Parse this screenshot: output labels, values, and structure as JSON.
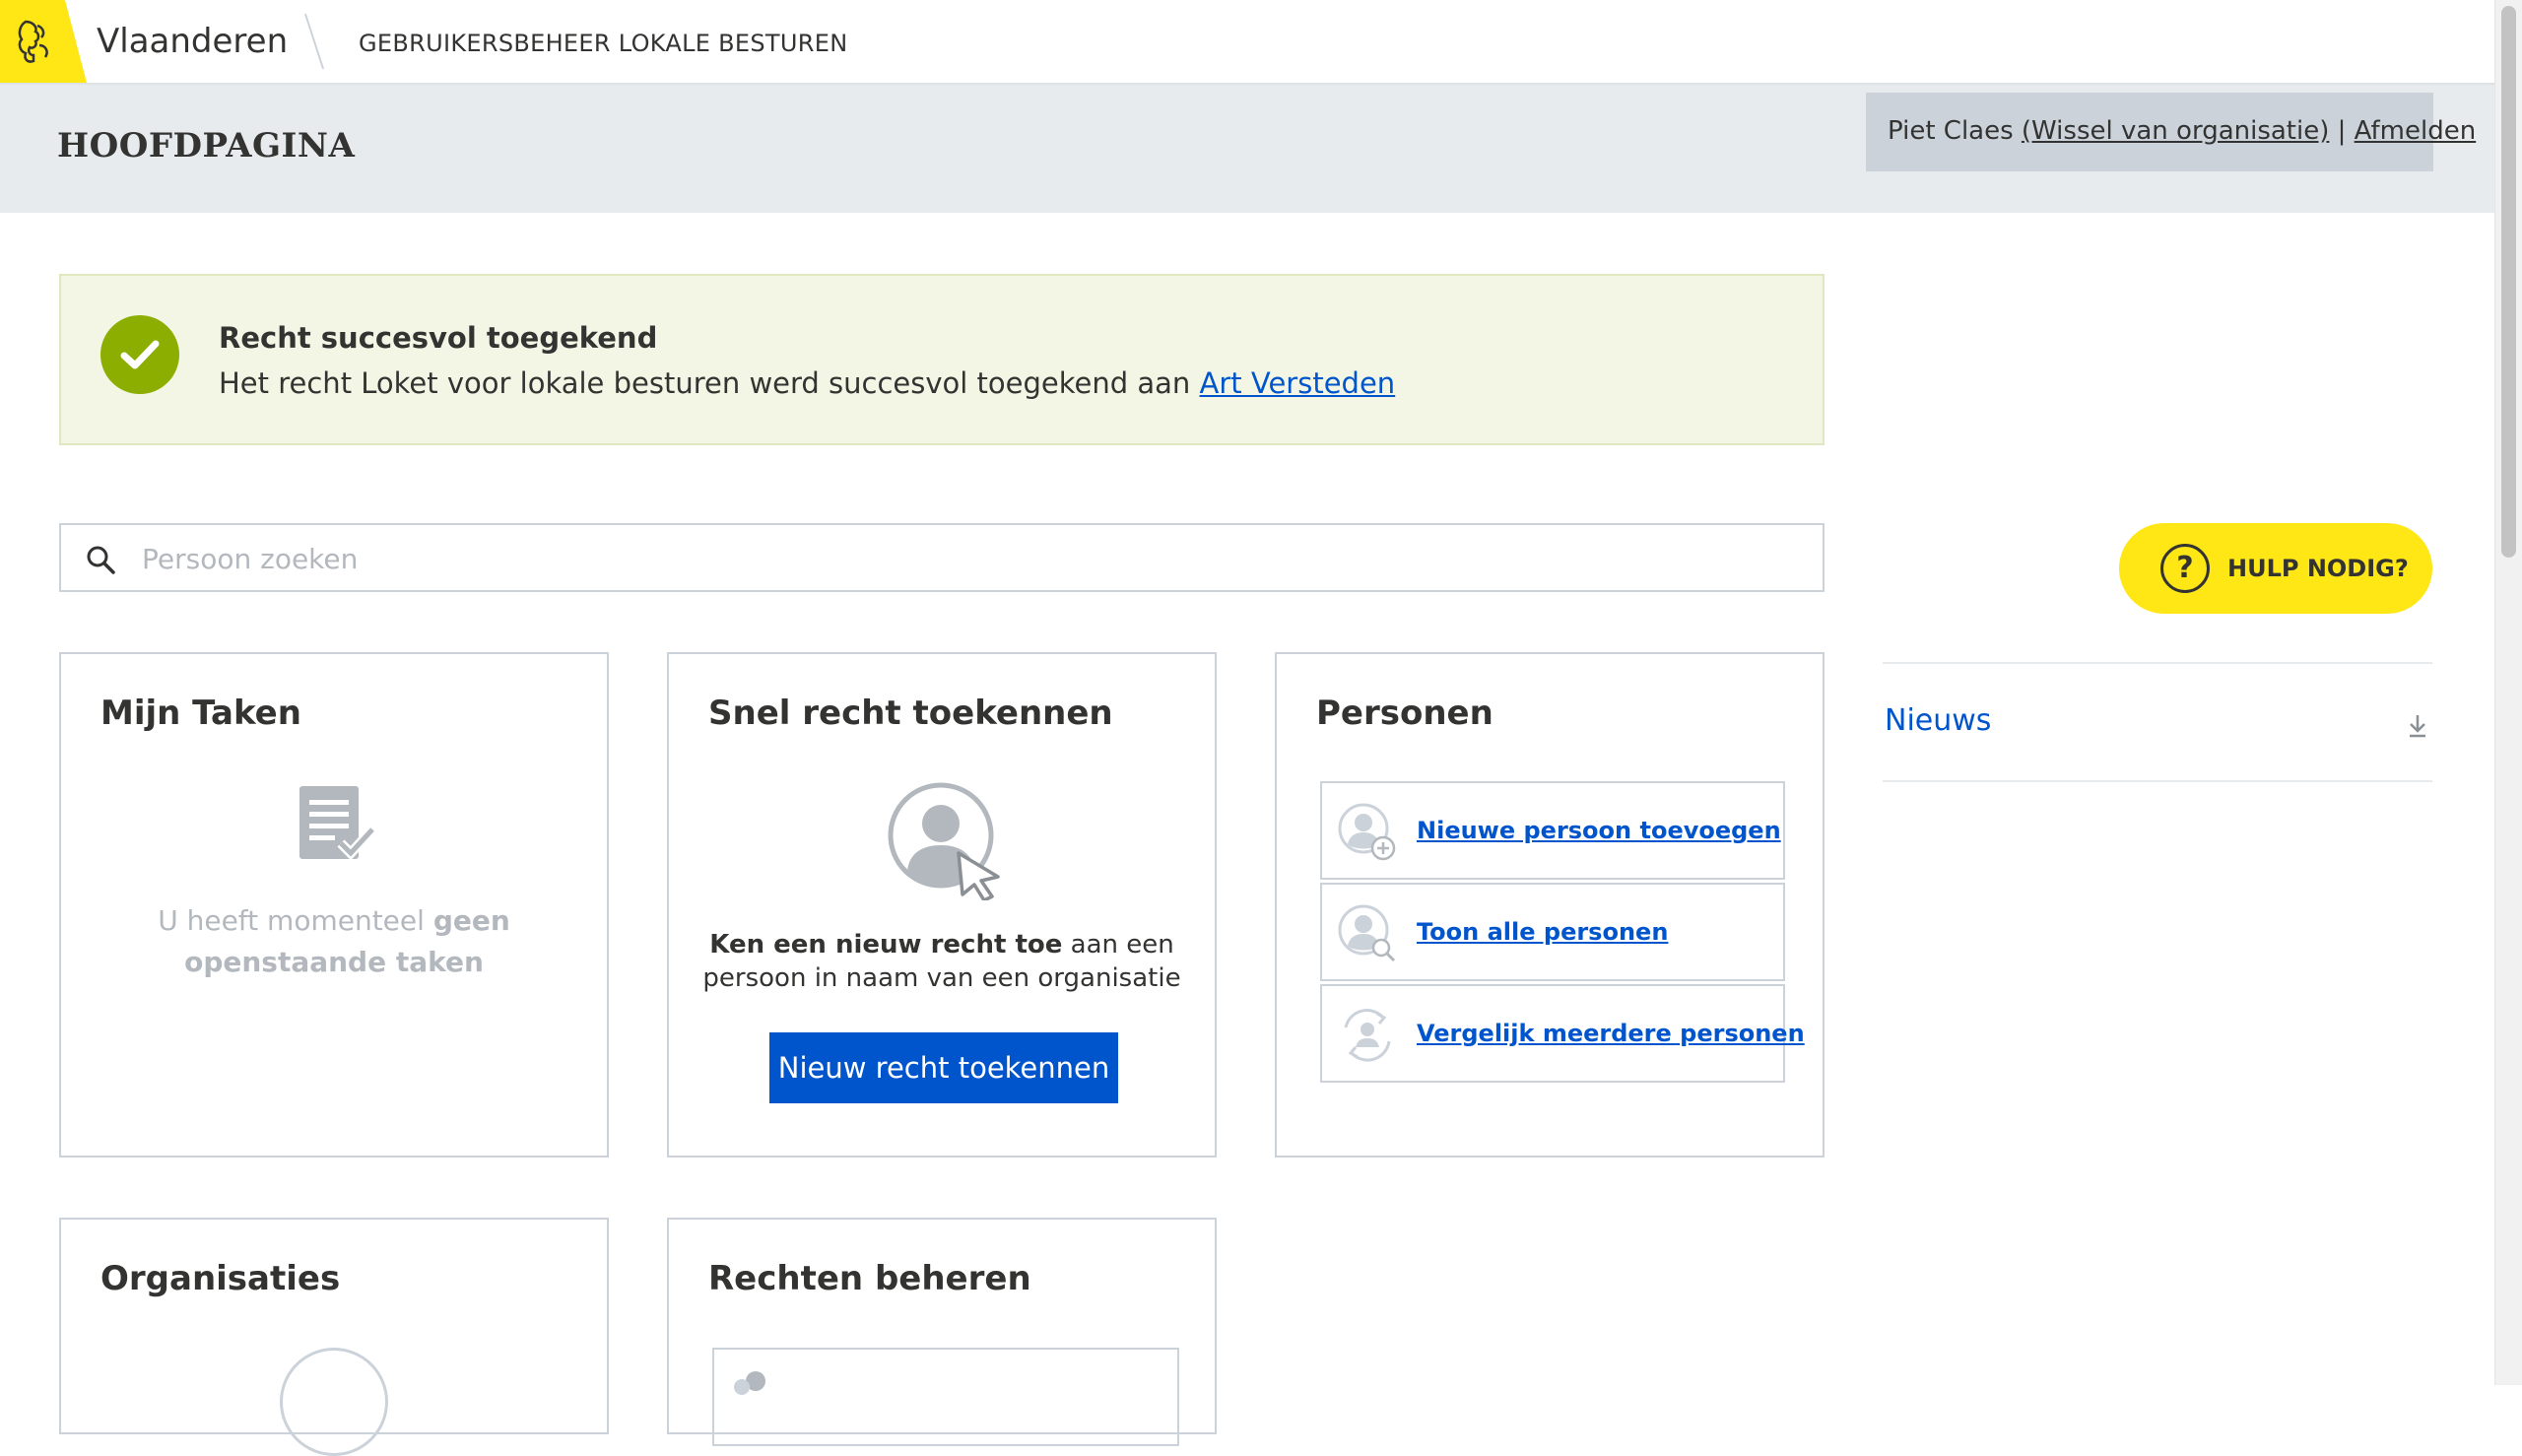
{
  "topbar": {
    "brand": "Vlaanderen",
    "app_name": "GEBRUIKERSBEHEER LOKALE BESTUREN"
  },
  "header": {
    "title": "HOOFDPAGINA",
    "user_name": "Piet Claes",
    "switch_org": "(Wissel van organisatie)",
    "separator": "|",
    "logout": "Afmelden"
  },
  "alert": {
    "title": "Recht succesvol toegekend",
    "text": "Het recht Loket voor lokale besturen werd succesvol toegekend aan",
    "link": "Art Versteden"
  },
  "search": {
    "placeholder": "Persoon zoeken",
    "value": ""
  },
  "help": {
    "label": "HULP NODIG?",
    "icon_glyph": "?"
  },
  "news": {
    "label": "Nieuws"
  },
  "cards": {
    "tasks": {
      "title": "Mijn Taken",
      "empty_prefix": "U heeft momenteel",
      "empty_bold": "geen openstaande taken"
    },
    "quick": {
      "title": "Snel recht toekennen",
      "desc_bold": "Ken een nieuw recht toe",
      "desc_rest": "aan een persoon in naam van een organisatie",
      "button": "Nieuw recht toekennen"
    },
    "persons": {
      "title": "Personen",
      "links": [
        {
          "label": "Nieuwe persoon toevoegen",
          "icon": "person-add-icon"
        },
        {
          "label": "Toon alle personen",
          "icon": "person-search-icon"
        },
        {
          "label": "Vergelijk meerdere personen",
          "icon": "person-compare-icon"
        }
      ]
    },
    "organisations": {
      "title": "Organisaties"
    },
    "rights": {
      "title": "Rechten beheren"
    }
  },
  "colors": {
    "brand_yellow": "#ffe615",
    "link_blue": "#0055cc",
    "success_green": "#8bae00",
    "alert_bg": "#f3f6e4",
    "header_bg": "#e8ebee"
  }
}
